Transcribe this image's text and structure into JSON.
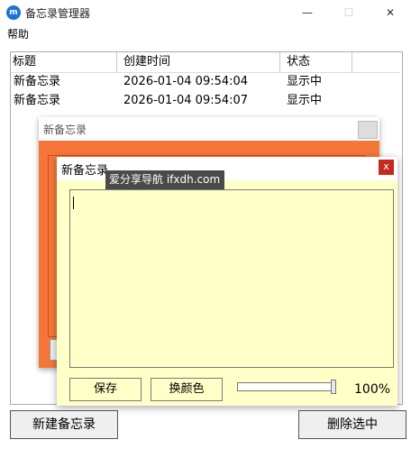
{
  "window": {
    "title": "备忘录管理器",
    "minimize": "—",
    "maximize": "☐",
    "close": "✕"
  },
  "menu": {
    "help": "帮助"
  },
  "table": {
    "headers": [
      "标题",
      "创建时间",
      "状态"
    ],
    "rows": [
      {
        "title": "新备忘录",
        "created": "2026-01-04 09:54:04",
        "status": "显示中"
      },
      {
        "title": "新备忘录",
        "created": "2026-01-04 09:54:07",
        "status": "显示中"
      }
    ]
  },
  "orange_note": {
    "title": "新备忘录",
    "color": "#f6763a"
  },
  "yellow_note": {
    "title": "新备忘录",
    "close": "x",
    "save_label": "保存",
    "color_label": "换颜色",
    "opacity": "100%",
    "opacity_value": 1.0,
    "color": "#ffffc8"
  },
  "tooltip": "爱分享导航 ifxdh.com",
  "buttons": {
    "new_note": "新建备忘录",
    "delete_selected": "删除选中"
  }
}
